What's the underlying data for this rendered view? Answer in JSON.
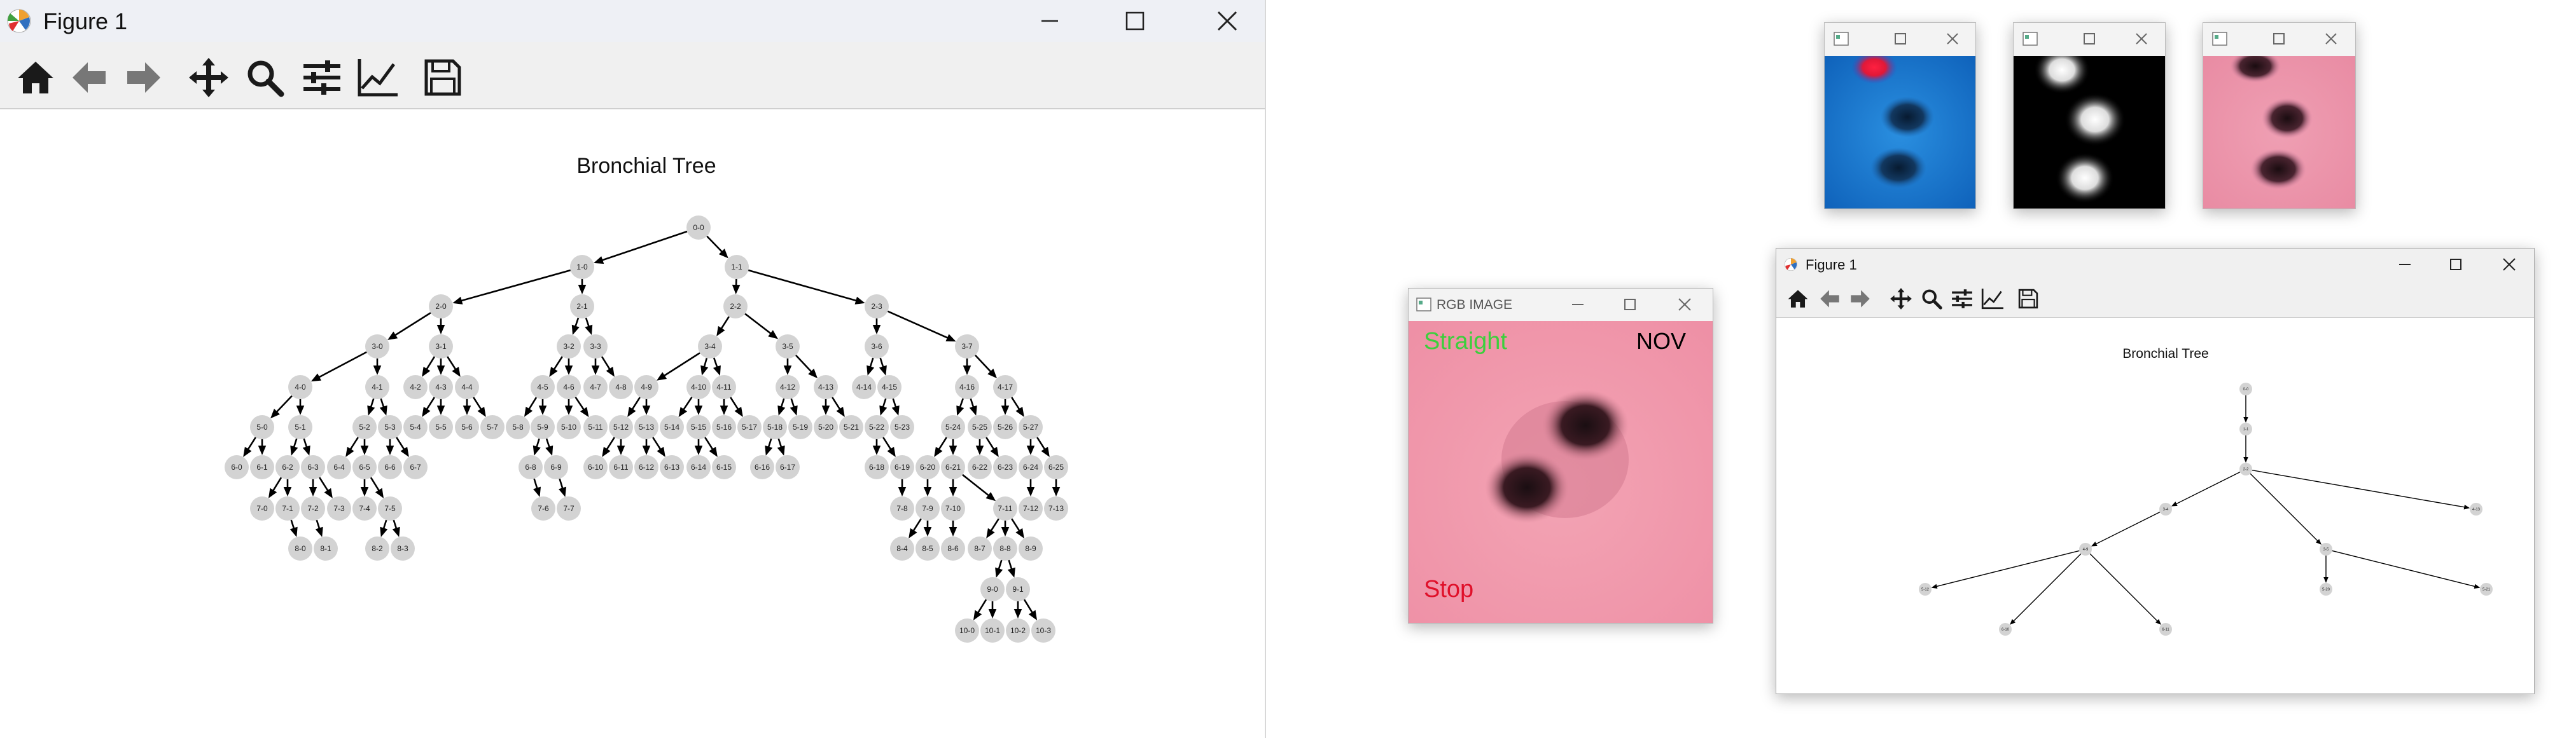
{
  "main_window": {
    "title": "Figure 1",
    "toolbar_icons": [
      "home-icon",
      "back-arrow-icon",
      "forward-arrow-icon",
      "pan-move-icon",
      "zoom-magnifier-icon",
      "configure-subplots-icon",
      "edit-axis-icon",
      "save-disk-icon"
    ],
    "plot_title": "Bronchial Tree"
  },
  "small_figure": {
    "title": "Figure 1",
    "plot_title": "Bronchial Tree"
  },
  "rgb_window": {
    "title": "RGB IMAGE",
    "direction_label": "Straight",
    "code_label": "NOV",
    "stop_label": "Stop",
    "colors": {
      "direction": "#3ccf3c",
      "stop": "#e0102a",
      "code": "#000000"
    }
  },
  "thumbnails": [
    {
      "kind": "blue-endoscopic-view"
    },
    {
      "kind": "grayscale-heatmap-view"
    },
    {
      "kind": "pink-endoscopic-view"
    }
  ],
  "chart_data": [
    {
      "type": "tree",
      "title": "Bronchial Tree",
      "nodes": [
        "0-0",
        "1-0",
        "1-1",
        "2-0",
        "2-1",
        "2-2",
        "2-3",
        "3-0",
        "3-1",
        "3-2",
        "3-3",
        "3-4",
        "3-5",
        "3-6",
        "3-7",
        "4-0",
        "4-1",
        "4-2",
        "4-3",
        "4-4",
        "4-5",
        "4-6",
        "4-7",
        "4-8",
        "4-9",
        "4-10",
        "4-11",
        "4-12",
        "4-13",
        "4-14",
        "4-15",
        "4-16",
        "4-17",
        "5-0",
        "5-1",
        "5-2",
        "5-3",
        "5-4",
        "5-5",
        "5-6",
        "5-7",
        "5-8",
        "5-9",
        "5-10",
        "5-11",
        "5-12",
        "5-13",
        "5-14",
        "5-15",
        "5-16",
        "5-17",
        "5-18",
        "5-19",
        "5-20",
        "5-21",
        "5-22",
        "5-23",
        "5-24",
        "5-25",
        "5-26",
        "5-27",
        "6-0",
        "6-1",
        "6-2",
        "6-3",
        "6-4",
        "6-5",
        "6-6",
        "6-7",
        "6-8",
        "6-9",
        "6-10",
        "6-11",
        "6-12",
        "6-13",
        "6-14",
        "6-15",
        "6-16",
        "6-17",
        "6-18",
        "6-19",
        "6-20",
        "6-21",
        "6-22",
        "6-23",
        "6-24",
        "6-25",
        "7-0",
        "7-1",
        "7-2",
        "7-3",
        "7-4",
        "7-5",
        "7-6",
        "7-7",
        "7-8",
        "7-9",
        "7-10",
        "7-11",
        "7-12",
        "7-13",
        "8-0",
        "8-1",
        "8-2",
        "8-3",
        "8-4",
        "8-5",
        "8-6",
        "8-7",
        "8-8",
        "8-9",
        "9-0",
        "9-1",
        "10-0",
        "10-1",
        "10-2",
        "10-3"
      ],
      "edges": [
        [
          "0-0",
          "1-0"
        ],
        [
          "0-0",
          "1-1"
        ],
        [
          "1-0",
          "2-0"
        ],
        [
          "1-0",
          "2-1"
        ],
        [
          "1-1",
          "2-2"
        ],
        [
          "1-1",
          "2-3"
        ],
        [
          "2-0",
          "3-0"
        ],
        [
          "2-0",
          "3-1"
        ],
        [
          "2-1",
          "3-2"
        ],
        [
          "2-1",
          "3-3"
        ],
        [
          "2-2",
          "3-4"
        ],
        [
          "2-2",
          "3-5"
        ],
        [
          "2-3",
          "3-6"
        ],
        [
          "2-3",
          "3-7"
        ],
        [
          "3-0",
          "4-0"
        ],
        [
          "3-0",
          "4-1"
        ],
        [
          "3-1",
          "4-2"
        ],
        [
          "3-1",
          "4-3"
        ],
        [
          "3-1",
          "4-4"
        ],
        [
          "3-2",
          "4-5"
        ],
        [
          "3-2",
          "4-6"
        ],
        [
          "3-3",
          "4-7"
        ],
        [
          "3-3",
          "4-8"
        ],
        [
          "3-4",
          "4-9"
        ],
        [
          "3-4",
          "4-10"
        ],
        [
          "3-4",
          "4-11"
        ],
        [
          "3-5",
          "4-12"
        ],
        [
          "3-5",
          "4-13"
        ],
        [
          "3-6",
          "4-14"
        ],
        [
          "3-6",
          "4-15"
        ],
        [
          "3-7",
          "4-16"
        ],
        [
          "3-7",
          "4-17"
        ],
        [
          "4-0",
          "5-0"
        ],
        [
          "4-0",
          "5-1"
        ],
        [
          "4-1",
          "5-2"
        ],
        [
          "4-1",
          "5-3"
        ],
        [
          "4-3",
          "5-4"
        ],
        [
          "4-3",
          "5-5"
        ],
        [
          "4-4",
          "5-6"
        ],
        [
          "4-4",
          "5-7"
        ],
        [
          "4-5",
          "5-8"
        ],
        [
          "4-5",
          "5-9"
        ],
        [
          "4-6",
          "5-10"
        ],
        [
          "4-6",
          "5-11"
        ],
        [
          "4-9",
          "5-12"
        ],
        [
          "4-9",
          "5-13"
        ],
        [
          "4-10",
          "5-14"
        ],
        [
          "4-10",
          "5-15"
        ],
        [
          "4-11",
          "5-16"
        ],
        [
          "4-11",
          "5-17"
        ],
        [
          "4-12",
          "5-18"
        ],
        [
          "4-12",
          "5-19"
        ],
        [
          "4-13",
          "5-20"
        ],
        [
          "4-13",
          "5-21"
        ],
        [
          "4-15",
          "5-22"
        ],
        [
          "4-15",
          "5-23"
        ],
        [
          "4-16",
          "5-24"
        ],
        [
          "4-16",
          "5-25"
        ],
        [
          "4-17",
          "5-26"
        ],
        [
          "4-17",
          "5-27"
        ],
        [
          "5-0",
          "6-0"
        ],
        [
          "5-0",
          "6-1"
        ],
        [
          "5-1",
          "6-2"
        ],
        [
          "5-1",
          "6-3"
        ],
        [
          "5-2",
          "6-4"
        ],
        [
          "5-2",
          "6-5"
        ],
        [
          "5-3",
          "6-6"
        ],
        [
          "5-3",
          "6-7"
        ],
        [
          "5-9",
          "6-8"
        ],
        [
          "5-9",
          "6-9"
        ],
        [
          "5-12",
          "6-10"
        ],
        [
          "5-12",
          "6-11"
        ],
        [
          "5-13",
          "6-12"
        ],
        [
          "5-13",
          "6-13"
        ],
        [
          "5-15",
          "6-14"
        ],
        [
          "5-15",
          "6-15"
        ],
        [
          "5-18",
          "6-16"
        ],
        [
          "5-18",
          "6-17"
        ],
        [
          "5-22",
          "6-18"
        ],
        [
          "5-22",
          "6-19"
        ],
        [
          "5-24",
          "6-20"
        ],
        [
          "5-24",
          "6-21"
        ],
        [
          "5-25",
          "6-22"
        ],
        [
          "5-25",
          "6-23"
        ],
        [
          "5-27",
          "6-24"
        ],
        [
          "5-27",
          "6-25"
        ],
        [
          "6-2",
          "7-0"
        ],
        [
          "6-2",
          "7-1"
        ],
        [
          "6-3",
          "7-2"
        ],
        [
          "6-3",
          "7-3"
        ],
        [
          "6-5",
          "7-4"
        ],
        [
          "6-5",
          "7-5"
        ],
        [
          "6-8",
          "7-6"
        ],
        [
          "6-9",
          "7-7"
        ],
        [
          "6-19",
          "7-8"
        ],
        [
          "6-20",
          "7-9"
        ],
        [
          "6-21",
          "7-10"
        ],
        [
          "6-21",
          "7-11"
        ],
        [
          "6-24",
          "7-12"
        ],
        [
          "6-25",
          "7-13"
        ],
        [
          "7-1",
          "8-0"
        ],
        [
          "7-2",
          "8-1"
        ],
        [
          "7-5",
          "8-2"
        ],
        [
          "7-5",
          "8-3"
        ],
        [
          "7-9",
          "8-4"
        ],
        [
          "7-9",
          "8-5"
        ],
        [
          "7-10",
          "8-6"
        ],
        [
          "7-11",
          "8-7"
        ],
        [
          "7-11",
          "8-8"
        ],
        [
          "7-11",
          "8-9"
        ],
        [
          "8-8",
          "9-0"
        ],
        [
          "8-8",
          "9-1"
        ],
        [
          "9-0",
          "10-0"
        ],
        [
          "9-0",
          "10-1"
        ],
        [
          "9-1",
          "10-2"
        ],
        [
          "9-1",
          "10-3"
        ]
      ]
    },
    {
      "type": "tree",
      "title": "Bronchial Tree",
      "nodes": [
        "0-0",
        "1-1",
        "2-2",
        "3-4",
        "3-5",
        "4-9",
        "4-13",
        "5-20",
        "5-21",
        "5-12",
        "6-10",
        "6-11"
      ],
      "edges": [
        [
          "0-0",
          "1-1"
        ],
        [
          "1-1",
          "2-2"
        ],
        [
          "2-2",
          "3-4"
        ],
        [
          "2-2",
          "3-5"
        ],
        [
          "2-2",
          "4-13"
        ],
        [
          "3-4",
          "4-9"
        ],
        [
          "3-5",
          "5-20"
        ],
        [
          "3-5",
          "5-21"
        ],
        [
          "4-9",
          "5-12"
        ],
        [
          "4-9",
          "6-10"
        ],
        [
          "4-9",
          "6-11"
        ]
      ]
    }
  ]
}
